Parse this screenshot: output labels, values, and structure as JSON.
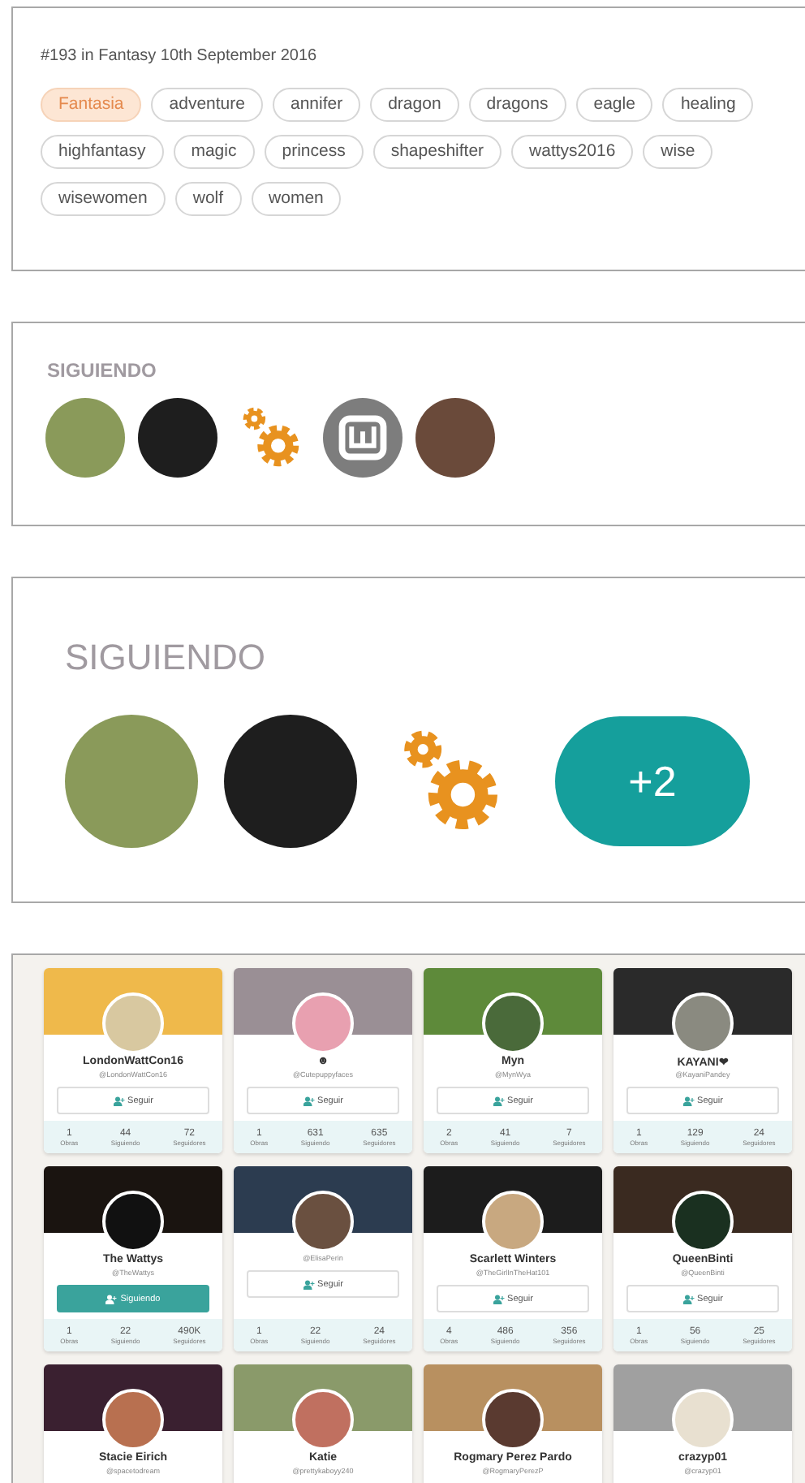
{
  "ranking": {
    "text": "#193 in Fantasy 10th September 2016"
  },
  "tags": [
    {
      "label": "Fantasia",
      "selected": true
    },
    {
      "label": "adventure",
      "selected": false
    },
    {
      "label": "annifer",
      "selected": false
    },
    {
      "label": "dragon",
      "selected": false
    },
    {
      "label": "dragons",
      "selected": false
    },
    {
      "label": "eagle",
      "selected": false
    },
    {
      "label": "healing",
      "selected": false
    },
    {
      "label": "highfantasy",
      "selected": false
    },
    {
      "label": "magic",
      "selected": false
    },
    {
      "label": "princess",
      "selected": false
    },
    {
      "label": "shapeshifter",
      "selected": false
    },
    {
      "label": "wattys2016",
      "selected": false
    },
    {
      "label": "wise",
      "selected": false
    },
    {
      "label": "wisewomen",
      "selected": false
    },
    {
      "label": "wolf",
      "selected": false
    },
    {
      "label": "women",
      "selected": false
    }
  ],
  "following_small": {
    "title": "SIGUIENDO",
    "items": [
      {
        "kind": "photo"
      },
      {
        "kind": "dark"
      },
      {
        "kind": "gears"
      },
      {
        "kind": "logo"
      },
      {
        "kind": "photo"
      }
    ]
  },
  "following_large": {
    "title": "SIGUIENDO",
    "items": [
      {
        "kind": "photo"
      },
      {
        "kind": "dark"
      },
      {
        "kind": "gears"
      },
      {
        "kind": "more",
        "text": "+2"
      }
    ]
  },
  "profiles": [
    {
      "name": "LondonWattCon16",
      "handle": "@LondonWattCon16",
      "button": "Seguir",
      "following": false,
      "stats": [
        {
          "value": "1",
          "label": "Obras"
        },
        {
          "value": "44",
          "label": "Siguiendo"
        },
        {
          "value": "72",
          "label": "Seguidores"
        }
      ]
    },
    {
      "name": "☻",
      "handle": "@Cutepuppyfaces",
      "button": "Seguir",
      "following": false,
      "stats": [
        {
          "value": "1",
          "label": "Obras"
        },
        {
          "value": "631",
          "label": "Siguiendo"
        },
        {
          "value": "635",
          "label": "Seguidores"
        }
      ]
    },
    {
      "name": "Myn",
      "handle": "@MynWya",
      "button": "Seguir",
      "following": false,
      "stats": [
        {
          "value": "2",
          "label": "Obras"
        },
        {
          "value": "41",
          "label": "Siguiendo"
        },
        {
          "value": "7",
          "label": "Seguidores"
        }
      ]
    },
    {
      "name": "KAYANI❤",
      "handle": "@KayaniPandey",
      "button": "Seguir",
      "following": false,
      "stats": [
        {
          "value": "1",
          "label": "Obras"
        },
        {
          "value": "129",
          "label": "Siguiendo"
        },
        {
          "value": "24",
          "label": "Seguidores"
        }
      ]
    },
    {
      "name": "The Wattys",
      "handle": "@TheWattys",
      "button": "Siguiendo",
      "following": true,
      "stats": [
        {
          "value": "1",
          "label": "Obras"
        },
        {
          "value": "22",
          "label": "Siguiendo"
        },
        {
          "value": "490K",
          "label": "Seguidores"
        }
      ]
    },
    {
      "handle": "@ElisaPerin",
      "button": "Seguir",
      "following": false,
      "stats": [
        {
          "value": "1",
          "label": "Obras"
        },
        {
          "value": "22",
          "label": "Siguiendo"
        },
        {
          "value": "24",
          "label": "Seguidores"
        }
      ]
    },
    {
      "name": "Scarlett Winters",
      "handle": "@TheGirlInTheHat101",
      "button": "Seguir",
      "following": false,
      "stats": [
        {
          "value": "4",
          "label": "Obras"
        },
        {
          "value": "486",
          "label": "Siguiendo"
        },
        {
          "value": "356",
          "label": "Seguidores"
        }
      ]
    },
    {
      "name": "QueenBinti",
      "handle": "@QueenBinti",
      "button": "Seguir",
      "following": false,
      "stats": [
        {
          "value": "1",
          "label": "Obras"
        },
        {
          "value": "56",
          "label": "Siguiendo"
        },
        {
          "value": "25",
          "label": "Seguidores"
        }
      ]
    },
    {
      "name": "Stacie Eirich",
      "handle": "@spacetodream"
    },
    {
      "name": "Katie",
      "handle": "@prettykaboyy240"
    },
    {
      "name": "Rogmary Perez Pardo",
      "handle": "@RogmaryPerezP"
    },
    {
      "name": "crazyp01",
      "handle": "@crazyp01"
    }
  ]
}
